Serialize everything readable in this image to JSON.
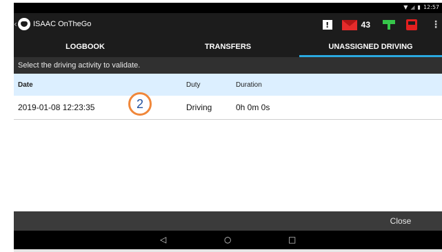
{
  "statusbar": {
    "time": "12:57",
    "wifi_icon": "wifi-icon",
    "battery_icon": "battery-icon"
  },
  "appbar": {
    "back_glyph": "‹",
    "app_title": "ISAAC OnTheGo",
    "alert_glyph": "!",
    "message_count": "43",
    "menu_glyph": "⋮"
  },
  "tabs": [
    {
      "label": "LOGBOOK",
      "active": false
    },
    {
      "label": "TRANSFERS",
      "active": false
    },
    {
      "label": "UNASSIGNED DRIVING",
      "active": true
    }
  ],
  "instruction": "Select the driving activity to validate.",
  "table": {
    "headers": [
      "Date",
      "Duty",
      "Duration"
    ],
    "rows": [
      [
        "2019-01-08 12:23:35",
        "Driving",
        "0h 0m 0s"
      ]
    ]
  },
  "callout": {
    "number": "2",
    "color": "#f0873a"
  },
  "footer": {
    "close_label": "Close"
  },
  "navbar": {
    "back": "◁",
    "home": "○",
    "recent": "□"
  },
  "colors": {
    "accent": "#2aa9e0",
    "header_bg": "#dcefff",
    "alert_red": "#e52b2b",
    "status_green": "#36c64a"
  }
}
